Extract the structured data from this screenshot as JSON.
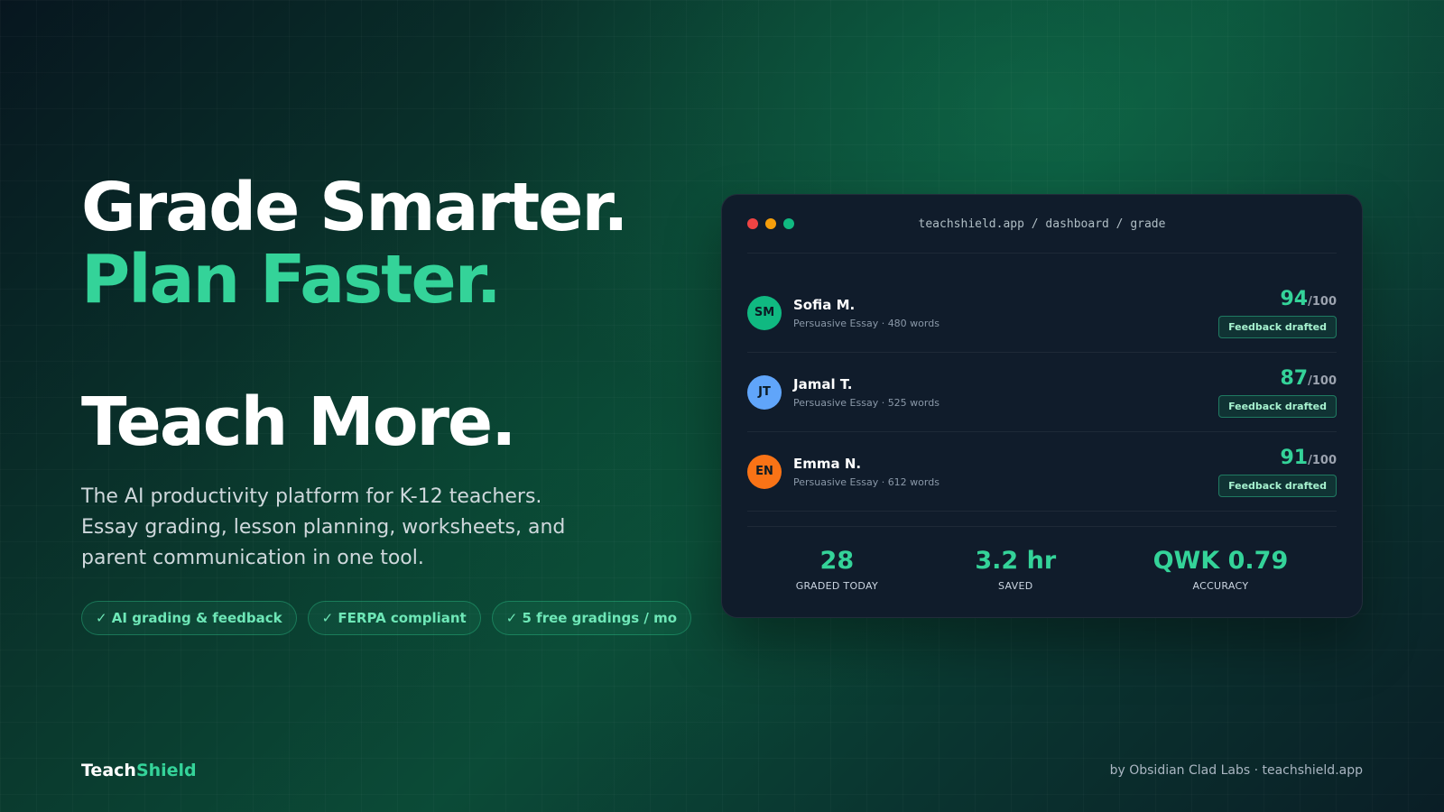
{
  "hero": {
    "line1": "Grade Smarter.",
    "line2": "Plan Faster.",
    "line3": "Teach More.",
    "description": "The AI productivity platform for K-12 teachers. Essay grading, lesson planning, worksheets, and parent communication in one tool.",
    "pills": [
      "✓ AI grading & feedback",
      "✓ FERPA compliant",
      "✓ 5 free gradings / mo"
    ]
  },
  "card": {
    "url": "teachshield.app / dashboard / grade",
    "students": [
      {
        "initials": "SM",
        "name": "Sofia M.",
        "meta": "Persuasive Essay · 480 words",
        "score": "94",
        "out_of": "/100",
        "status": "Feedback drafted",
        "avatar_color": "#10b981"
      },
      {
        "initials": "JT",
        "name": "Jamal T.",
        "meta": "Persuasive Essay · 525 words",
        "score": "87",
        "out_of": "/100",
        "status": "Feedback drafted",
        "avatar_color": "#60a5fa"
      },
      {
        "initials": "EN",
        "name": "Emma N.",
        "meta": "Persuasive Essay · 612 words",
        "score": "91",
        "out_of": "/100",
        "status": "Feedback drafted",
        "avatar_color": "#f97316"
      }
    ],
    "stats": [
      {
        "value": "28",
        "label": "GRADED TODAY"
      },
      {
        "value": "3.2 hr",
        "label": "SAVED"
      },
      {
        "value": "QWK 0.79",
        "label": "ACCURACY"
      }
    ]
  },
  "brand": {
    "part1": "Teach",
    "part2": "Shield"
  },
  "footer": {
    "credit": "by Obsidian Clad Labs · teachshield.app"
  },
  "colors": {
    "accent": "#34d399",
    "card_bg": "#101c2b"
  }
}
